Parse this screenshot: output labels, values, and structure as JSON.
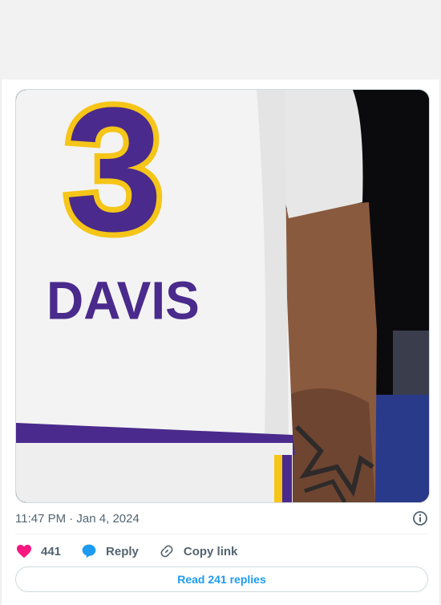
{
  "tweet": {
    "timestamp": "11:47 PM · Jan 4, 2024",
    "media": {
      "jersey_number": "3",
      "jersey_name": "DAVIS"
    },
    "actions": {
      "like_count": "441",
      "reply_label": "Reply",
      "copy_link_label": "Copy link"
    },
    "read_replies_label": "Read 241 replies"
  },
  "colors": {
    "like_pink": "#f91880",
    "reply_blue": "#1d9bf0",
    "muted_gray": "#536471",
    "lakers_purple": "#4a2a8c",
    "lakers_gold": "#f5c518"
  },
  "icons": [
    "info-icon",
    "heart-icon",
    "reply-bubble-icon",
    "link-icon"
  ]
}
